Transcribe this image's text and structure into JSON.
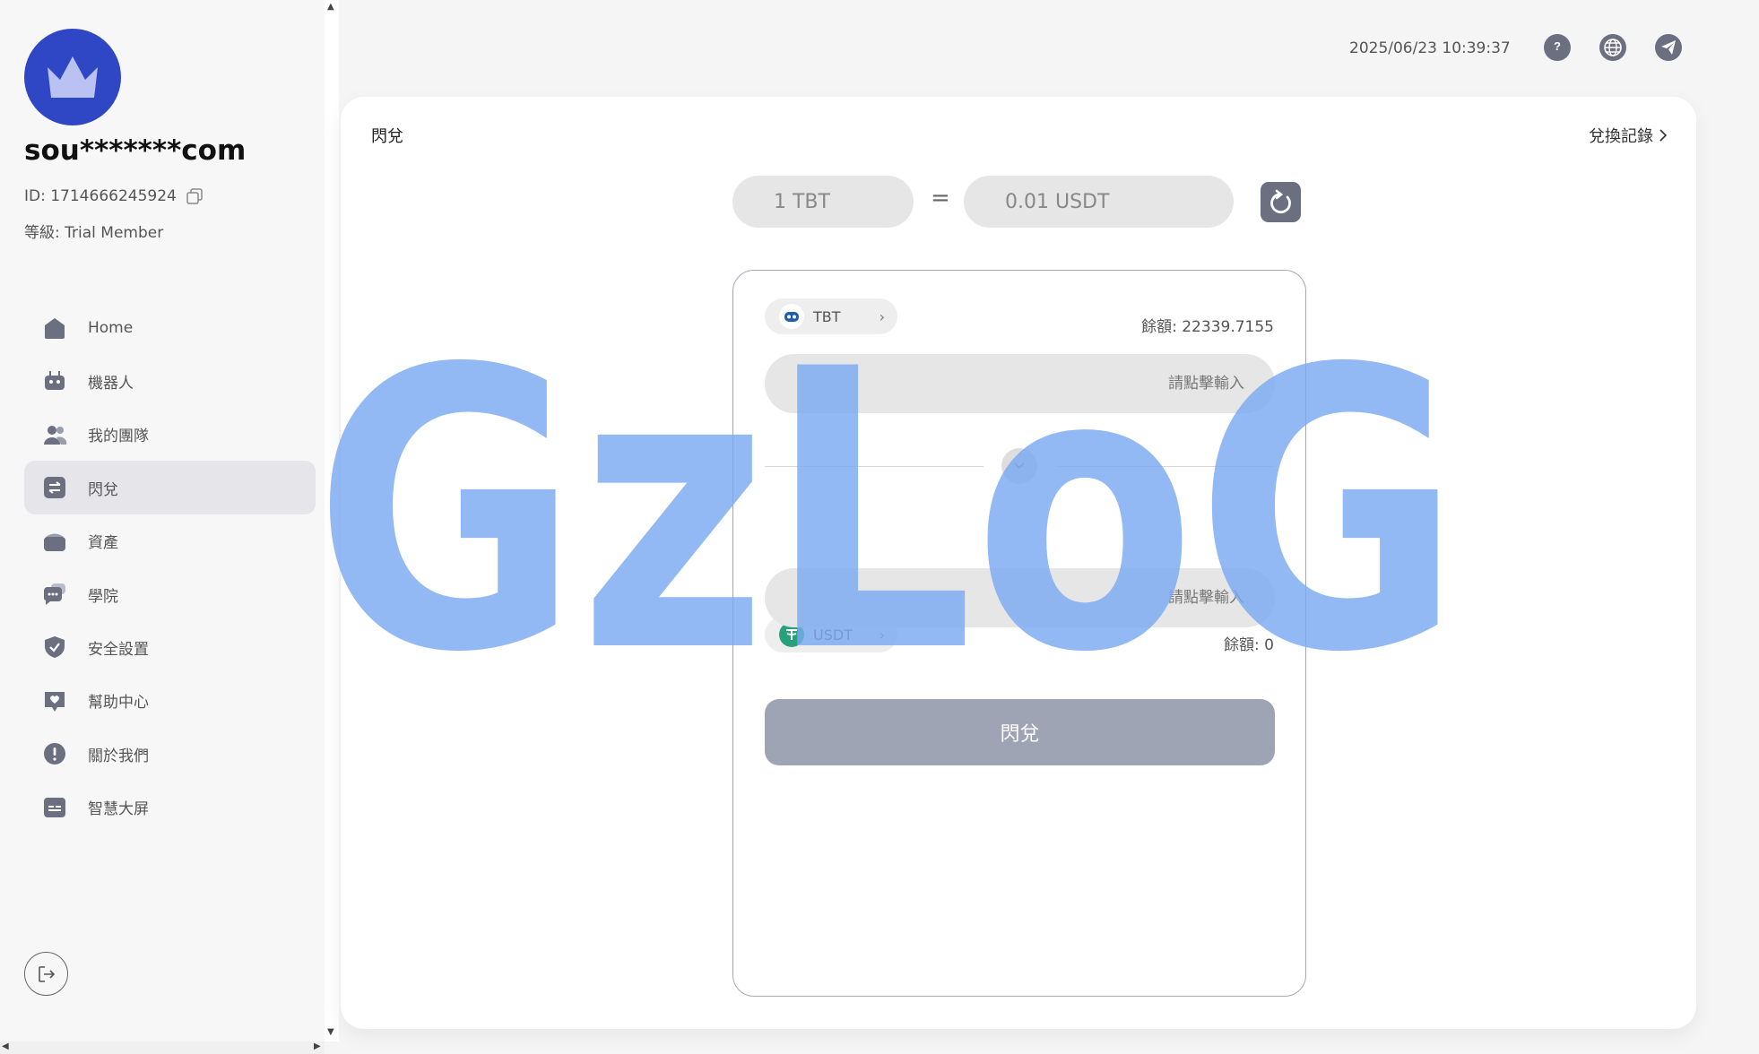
{
  "user": {
    "name": "sou*******com",
    "id_text": "ID: 1714666245924",
    "level_text": "等級: Trial Member"
  },
  "sidebar": {
    "items": [
      {
        "label": "Home",
        "icon": "home-icon"
      },
      {
        "label": "機器人",
        "icon": "robot-icon"
      },
      {
        "label": "我的團隊",
        "icon": "team-icon"
      },
      {
        "label": "閃兌",
        "icon": "swap-icon",
        "active": true
      },
      {
        "label": "資產",
        "icon": "wallet-icon"
      },
      {
        "label": "學院",
        "icon": "chat-icon"
      },
      {
        "label": "安全設置",
        "icon": "shield-icon"
      },
      {
        "label": "幫助中心",
        "icon": "heart-icon"
      },
      {
        "label": "關於我們",
        "icon": "info-icon"
      },
      {
        "label": "智慧大屏",
        "icon": "screen-icon"
      }
    ]
  },
  "header": {
    "datetime": "2025/06/23 10:39:37"
  },
  "swap": {
    "title": "閃兌",
    "history_label": "兌換記錄",
    "rate_from": "1 TBT",
    "rate_eq": "=",
    "rate_to": "0.01 USDT",
    "from": {
      "token": "TBT",
      "balance": "餘額: 22339.7155",
      "placeholder": "請點擊輸入"
    },
    "to": {
      "token": "USDT",
      "balance": "餘額: 0",
      "placeholder": "請點擊輸入"
    },
    "submit_label": "閃兌"
  },
  "watermark": {
    "text": "GzLoG"
  },
  "colors": {
    "accent": "#2f47c4",
    "icon_gray": "#6b6f80",
    "button_disabled": "#9fa4b4",
    "watermark": "#7aaaf0",
    "tether": "#26a17b"
  }
}
